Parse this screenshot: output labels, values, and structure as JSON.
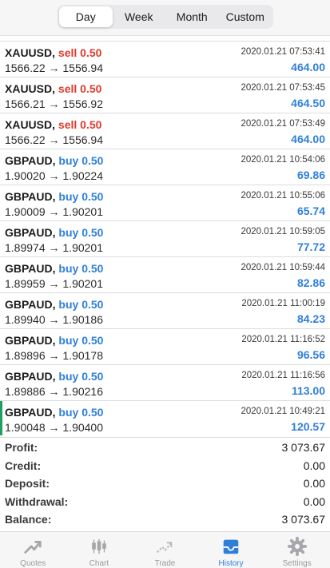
{
  "periods": [
    {
      "label": "Day",
      "active": true
    },
    {
      "label": "Week",
      "active": false
    },
    {
      "label": "Month",
      "active": false
    },
    {
      "label": "Custom",
      "active": false
    }
  ],
  "deals": [
    {
      "symbol": "XAUUSD,",
      "side": "sell",
      "volume": "0.50",
      "open": "1566.22",
      "arrow": "→",
      "close": "1556.94",
      "time": "2020.01.21 07:53:41",
      "profit": "464.00"
    },
    {
      "symbol": "XAUUSD,",
      "side": "sell",
      "volume": "0.50",
      "open": "1566.21",
      "arrow": "→",
      "close": "1556.92",
      "time": "2020.01.21 07:53:45",
      "profit": "464.50"
    },
    {
      "symbol": "XAUUSD,",
      "side": "sell",
      "volume": "0.50",
      "open": "1566.22",
      "arrow": "→",
      "close": "1556.94",
      "time": "2020.01.21 07:53:49",
      "profit": "464.00"
    },
    {
      "symbol": "GBPAUD,",
      "side": "buy",
      "volume": "0.50",
      "open": "1.90020",
      "arrow": "→",
      "close": "1.90224",
      "time": "2020.01.21 10:54:06",
      "profit": "69.86"
    },
    {
      "symbol": "GBPAUD,",
      "side": "buy",
      "volume": "0.50",
      "open": "1.90009",
      "arrow": "→",
      "close": "1.90201",
      "time": "2020.01.21 10:55:06",
      "profit": "65.74"
    },
    {
      "symbol": "GBPAUD,",
      "side": "buy",
      "volume": "0.50",
      "open": "1.89974",
      "arrow": "→",
      "close": "1.90201",
      "time": "2020.01.21 10:59:05",
      "profit": "77.72"
    },
    {
      "symbol": "GBPAUD,",
      "side": "buy",
      "volume": "0.50",
      "open": "1.89959",
      "arrow": "→",
      "close": "1.90201",
      "time": "2020.01.21 10:59:44",
      "profit": "82.86"
    },
    {
      "symbol": "GBPAUD,",
      "side": "buy",
      "volume": "0.50",
      "open": "1.89940",
      "arrow": "→",
      "close": "1.90186",
      "time": "2020.01.21 11:00:19",
      "profit": "84.23"
    },
    {
      "symbol": "GBPAUD,",
      "side": "buy",
      "volume": "0.50",
      "open": "1.89896",
      "arrow": "→",
      "close": "1.90178",
      "time": "2020.01.21 11:16:52",
      "profit": "96.56"
    },
    {
      "symbol": "GBPAUD,",
      "side": "buy",
      "volume": "0.50",
      "open": "1.89886",
      "arrow": "→",
      "close": "1.90216",
      "time": "2020.01.21 11:16:56",
      "profit": "113.00"
    },
    {
      "symbol": "GBPAUD,",
      "side": "buy",
      "volume": "0.50",
      "open": "1.90048",
      "arrow": "→",
      "close": "1.90400",
      "time": "2020.01.21 10:49:21",
      "profit": "120.57",
      "selected": true
    }
  ],
  "summary": {
    "profit_label": "Profit:",
    "profit": "3 073.67",
    "credit_label": "Credit:",
    "credit": "0.00",
    "deposit_label": "Deposit:",
    "deposit": "0.00",
    "withdrawal_label": "Withdrawal:",
    "withdrawal": "0.00",
    "balance_label": "Balance:",
    "balance": "3 073.67"
  },
  "tabs": [
    {
      "label": "Quotes",
      "icon": "quotes-icon",
      "active": false
    },
    {
      "label": "Chart",
      "icon": "chart-icon",
      "active": false
    },
    {
      "label": "Trade",
      "icon": "trade-icon",
      "active": false
    },
    {
      "label": "History",
      "icon": "history-icon",
      "active": true
    },
    {
      "label": "Settings",
      "icon": "gear-icon",
      "active": false
    }
  ],
  "colors": {
    "accent": "#2f7fd9",
    "sell": "#e0392c",
    "buy": "#2f7fd9",
    "selected_marker": "#1aa260"
  }
}
